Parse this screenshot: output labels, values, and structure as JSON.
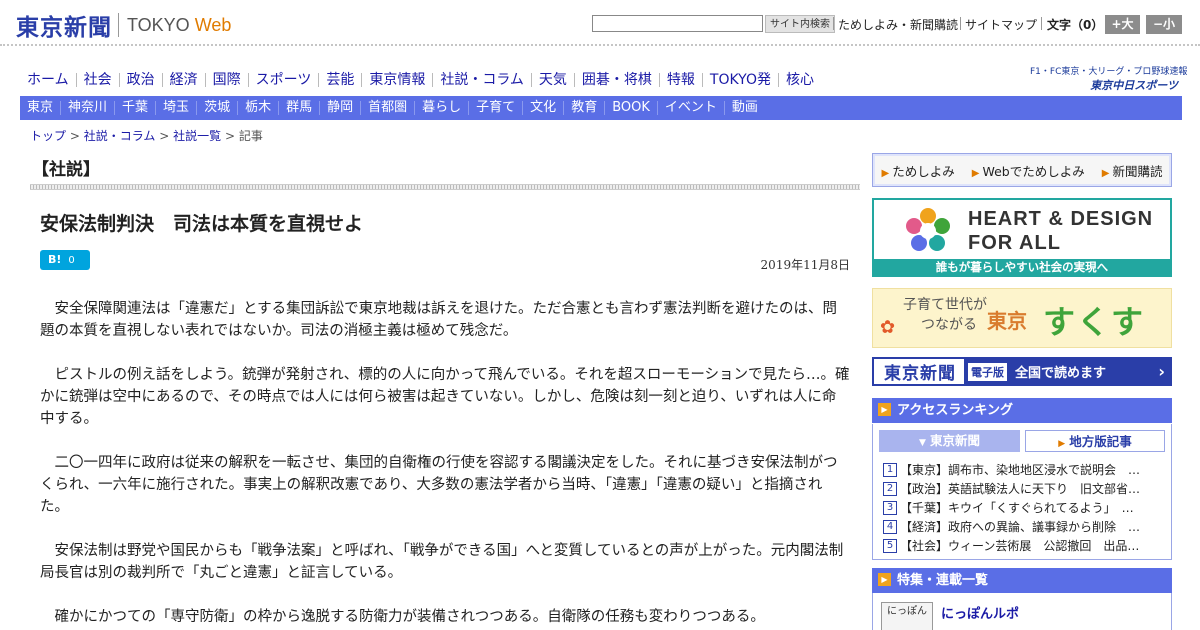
{
  "header": {
    "logo_jp": "東京新聞",
    "logo_tokyo": "TOKYO",
    "logo_web": "Web",
    "search_button": "サイト内検索",
    "links": [
      "ためしよみ・新聞購読",
      "サイトマップ"
    ],
    "font_size_label": "文字（0）",
    "font_bigger": "+大",
    "font_smaller": "−小"
  },
  "main_nav": [
    "ホーム",
    "社会",
    "政治",
    "経済",
    "国際",
    "スポーツ",
    "芸能",
    "東京情報",
    "社説・コラム",
    "天気",
    "囲碁・将棋",
    "特報",
    "TOKYO発",
    "核心"
  ],
  "chunichi": {
    "top": "F1・FC東京・大リーグ・プロ野球速報",
    "bottom": "東京中日スポーツ"
  },
  "sub_nav": [
    "東京",
    "神奈川",
    "千葉",
    "埼玉",
    "茨城",
    "栃木",
    "群馬",
    "静岡",
    "首都圏",
    "暮らし",
    "子育て",
    "文化",
    "教育",
    "BOOK",
    "イベント",
    "動画"
  ],
  "breadcrumb": {
    "items": [
      "トップ",
      "社説・コラム",
      "社説一覧"
    ],
    "current": "記事",
    "sep": ">"
  },
  "article": {
    "section": "【社説】",
    "title": "安保法制判決　司法は本質を直視せよ",
    "hatena_label": "B!",
    "hatena_count": "0",
    "date": "2019年11月8日",
    "paragraphs": [
      "安全保障関連法は「違憲だ」とする集団訴訟で東京地裁は訴えを退けた。ただ合憲とも言わず憲法判断を避けたのは、問題の本質を直視しない表れではないか。司法の消極主義は極めて残念だ。",
      "ピストルの例え話をしよう。銃弾が発射され、標的の人に向かって飛んでいる。それを超スローモーションで見たら…。確かに銃弾は空中にあるので、その時点では人には何ら被害は起きていない。しかし、危険は刻一刻と迫り、いずれは人に命中する。",
      "二〇一四年に政府は従来の解釈を一転させ、集団的自衛権の行使を容認する閣議決定をした。それに基づき安保法制がつくられ、一六年に施行された。事実上の解釈改憲であり、大多数の憲法学者から当時、「違憲」「違憲の疑い」と指摘された。",
      "安保法制は野党や国民からも「戦争法案」と呼ばれ、「戦争ができる国」へと変質しているとの声が上がった。元内閣法制局長官は別の裁判所で「丸ごと違憲」と証言している。",
      "確かにかつての「専守防衛」の枠から逸脱する防衛力が装備されつつある。自衛隊の任務も変わりつつある。"
    ]
  },
  "sidebar": {
    "tabs": [
      "ためしよみ",
      "Webでためしよみ",
      "新聞購読"
    ],
    "heart_line1": "HEART & DESIGN",
    "heart_line2": "FOR ALL",
    "heart_caption": "誰もが暮らしやすい社会の実現へ",
    "suku_left1": "子育て世代が",
    "suku_left2": "つながる",
    "suku_tokyo": "東京",
    "suku_big": "すくすく",
    "eban_logo": "東京新聞",
    "eban_tag": "電子版",
    "eban_text": "全国で読めます",
    "ranking_title": "アクセスランキング",
    "ranking_tabs": [
      "東京新聞",
      "地方版記事"
    ],
    "ranking": [
      {
        "num": "1",
        "text": "【東京】調布市、染地地区浸水で説明会　…"
      },
      {
        "num": "2",
        "text": "【政治】英語試験法人に天下り　旧文部省…"
      },
      {
        "num": "3",
        "text": "【千葉】キウイ「くすぐられてるよう」　…"
      },
      {
        "num": "4",
        "text": "【経済】政府への異論、議事録から削除　…"
      },
      {
        "num": "5",
        "text": "【社会】ウィーン芸術展　公認撤回　出品…"
      }
    ],
    "tokushu_title": "特集・連載一覧",
    "tokushu_thumb": "にっぽん",
    "tokushu_item": "にっぽんルポ"
  },
  "colors": {
    "brand_blue": "#2a3ea8",
    "nav_blue": "#5a6ee6",
    "accent_orange": "#e07b00",
    "teal": "#22a7a0"
  }
}
